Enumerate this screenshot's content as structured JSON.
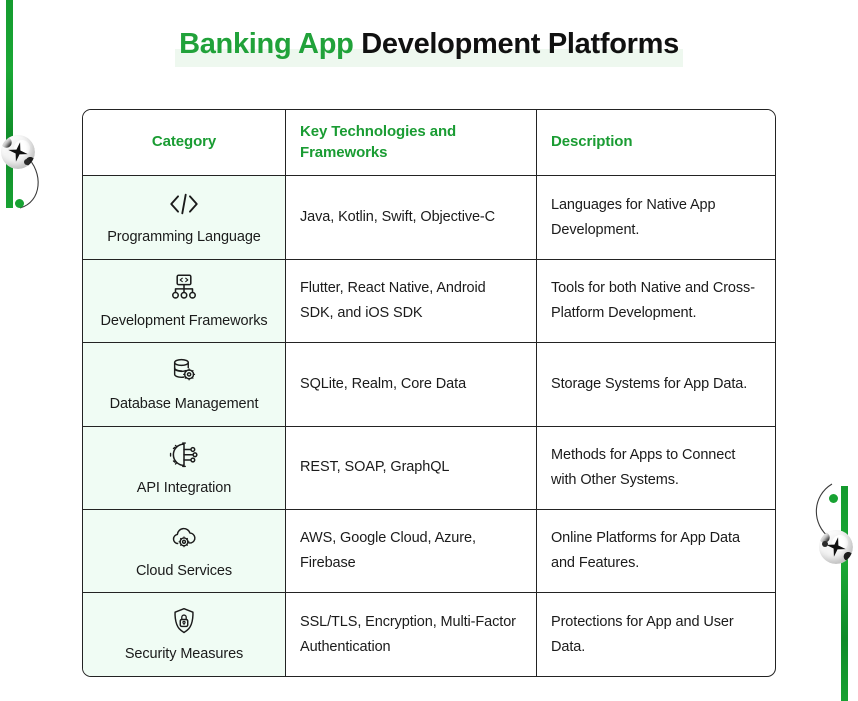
{
  "title": {
    "accent": "Banking App",
    "rest": " Development Platforms"
  },
  "colors": {
    "accent_green": "#21a23a",
    "header_green": "#1a9c33",
    "category_cell_bg": "#f0fcf4",
    "title_band": "#eef8ef",
    "border": "#232323",
    "text": "#1b1b1b"
  },
  "table": {
    "headers": {
      "category": "Category",
      "technologies": "Key Technologies and Frameworks",
      "description": "Description"
    },
    "rows": [
      {
        "icon": "code-brackets-icon",
        "category": "Programming Language",
        "technologies": "Java, Kotlin, Swift, Objective-C",
        "description": "Languages for Native App Development."
      },
      {
        "icon": "framework-sitemap-icon",
        "category": "Development Frameworks",
        "technologies": "Flutter, React Native, Android SDK, and iOS SDK",
        "description": "Tools for both Native and Cross-Platform Development."
      },
      {
        "icon": "database-gear-icon",
        "category": "Database Management",
        "technologies": "SQLite, Realm, Core Data",
        "description": "Storage Systems for App Data."
      },
      {
        "icon": "api-gear-circuit-icon",
        "category": "API Integration",
        "technologies": "REST, SOAP, GraphQL",
        "description": "Methods for Apps to Connect with Other Systems."
      },
      {
        "icon": "cloud-gear-icon",
        "category": "Cloud Services",
        "technologies": "AWS, Google Cloud, Azure, Firebase",
        "description": "Online Platforms for App Data and Features."
      },
      {
        "icon": "shield-lock-icon",
        "category": "Security Measures",
        "technologies": "SSL/TLS, Encryption, Multi-Factor Authentication",
        "description": "Protections for App and User Data."
      }
    ]
  },
  "decorations": {
    "left_bar": "green-vertical-bar",
    "right_bar": "green-vertical-bar",
    "left_orb": "sphere-ornament",
    "right_orb": "sphere-ornament"
  }
}
